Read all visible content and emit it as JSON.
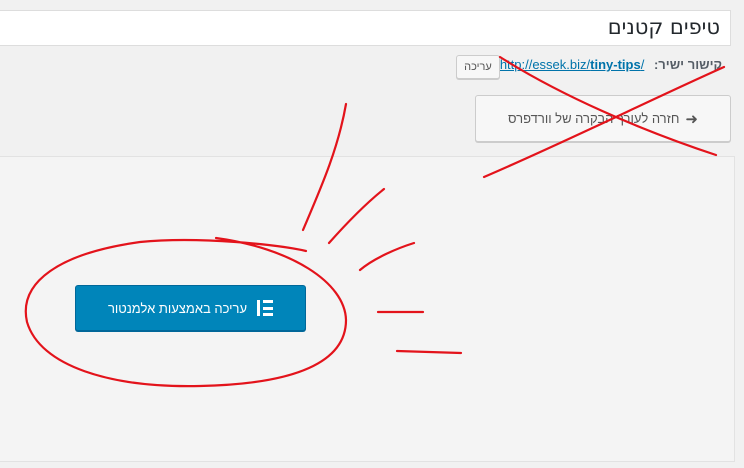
{
  "post": {
    "title": "טיפים קטנים"
  },
  "permalink": {
    "label": "קישור ישיר:",
    "url_base": "http://essek.biz/",
    "url_slug": "tiny-tips",
    "url_tail": "/",
    "edit_button": "עריכה"
  },
  "actions": {
    "back_to_wordpress": "חזרה לעורך הבקרה של וורדפרס",
    "edit_with_elementor": "עריכה באמצעות אלמנטור"
  },
  "colors": {
    "primary_button": "#0085ba",
    "link": "#0073aa",
    "annotation": "#e3131b"
  },
  "icons": {
    "back": "arrow-right-icon",
    "elementor": "elementor-logo-icon"
  }
}
